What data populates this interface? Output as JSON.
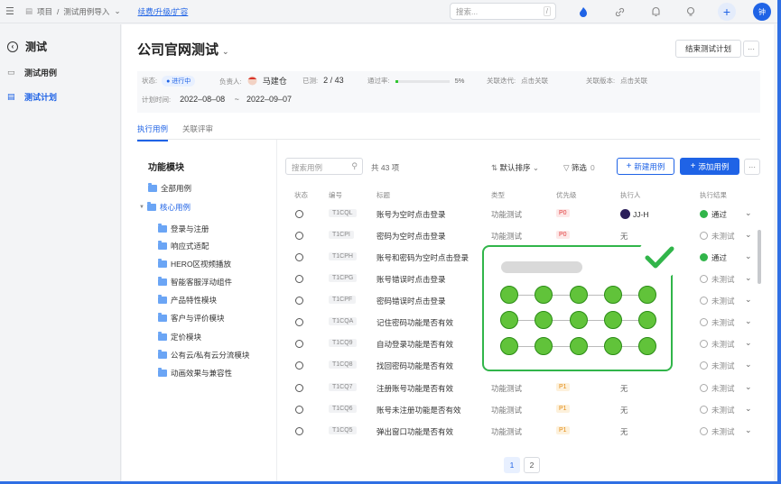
{
  "topbar": {
    "breadcrumb": [
      "项目",
      "/",
      "测试用例导入"
    ],
    "upgrade_link": "续费/升级/扩容",
    "search_placeholder": "搜索...",
    "search_shortcut": "/",
    "user_initial": "钟"
  },
  "sidebar": {
    "title": "测试",
    "items": [
      {
        "label": "测试用例",
        "icon": "file-icon",
        "active": false
      },
      {
        "label": "测试计划",
        "icon": "plan-icon",
        "active": true
      }
    ]
  },
  "page": {
    "title": "公司官网测试",
    "end_button": "结束测试计划",
    "more": "···"
  },
  "info": {
    "status_label": "状态:",
    "status_value": "进行中",
    "owner_label": "负责人:",
    "owner_value": "马建仓",
    "tested_label": "已测:",
    "tested_value": "2 / 43",
    "pass_rate_label": "通过率:",
    "pass_rate_value": "5%",
    "pass_rate_fraction": 0.05,
    "iteration_label": "关联迭代:",
    "iteration_value": "点击关联",
    "version_label": "关联版本:",
    "version_value": "点击关联",
    "plan_time_label": "计划时间:",
    "start_date": "2022–08–08",
    "date_sep": "~",
    "end_date": "2022–09–07"
  },
  "tabs": [
    "执行用例",
    "关联评审"
  ],
  "tree": {
    "heading": "功能模块",
    "nodes": [
      {
        "label": "全部用例",
        "level": 0
      },
      {
        "label": "核心用例",
        "level": 0,
        "expanded": true
      },
      {
        "label": "登录与注册",
        "level": 1
      },
      {
        "label": "响应式适配",
        "level": 1
      },
      {
        "label": "HERO区视频播放",
        "level": 1
      },
      {
        "label": "智能客服浮动组件",
        "level": 1
      },
      {
        "label": "产品特性模块",
        "level": 1
      },
      {
        "label": "客户与评价模块",
        "level": 1
      },
      {
        "label": "定价模块",
        "level": 1
      },
      {
        "label": "公有云/私有云分流模块",
        "level": 1
      },
      {
        "label": "动画效果与兼容性",
        "level": 1
      }
    ]
  },
  "toolbar": {
    "search_placeholder": "搜索用例",
    "count": "共 43 项",
    "sort": "默认排序",
    "filter": "筛选",
    "filter_count": "0",
    "new_case": "新建用例",
    "add_case": "添加用例"
  },
  "table": {
    "columns": [
      "状态",
      "编号",
      "标题",
      "类型",
      "优先级",
      "执行人",
      "执行结果"
    ],
    "rows": [
      {
        "code": "T1CQL",
        "title": "账号为空时点击登录",
        "type": "功能测试",
        "priority": "P0",
        "executor": "JJ-H",
        "result": "通过"
      },
      {
        "code": "T1CPI",
        "title": "密码为空时点击登录",
        "type": "功能测试",
        "priority": "P0",
        "executor": "无",
        "result": "未测试"
      },
      {
        "code": "T1CPH",
        "title": "账号和密码为空时点击登录",
        "type": "",
        "priority": "",
        "executor": "",
        "result": "通过"
      },
      {
        "code": "T1CPG",
        "title": "账号错误时点击登录",
        "type": "",
        "priority": "",
        "executor": "",
        "result": "未测试"
      },
      {
        "code": "T1CPF",
        "title": "密码错误时点击登录",
        "type": "",
        "priority": "",
        "executor": "",
        "result": "未测试"
      },
      {
        "code": "T1CQA",
        "title": "记住密码功能是否有效",
        "type": "",
        "priority": "",
        "executor": "",
        "result": "未测试"
      },
      {
        "code": "T1CQ9",
        "title": "自动登录功能是否有效",
        "type": "",
        "priority": "",
        "executor": "",
        "result": "未测试"
      },
      {
        "code": "T1CQ8",
        "title": "找回密码功能是否有效",
        "type": "",
        "priority": "",
        "executor": "",
        "result": "未测试"
      },
      {
        "code": "T1CQ7",
        "title": "注册账号功能是否有效",
        "type": "功能测试",
        "priority": "P1",
        "executor": "无",
        "result": "未测试"
      },
      {
        "code": "T1CQ6",
        "title": "账号未注册功能是否有效",
        "type": "功能测试",
        "priority": "P1",
        "executor": "无",
        "result": "未测试"
      },
      {
        "code": "T1CQ5",
        "title": "弹出窗口功能是否有效",
        "type": "功能测试",
        "priority": "P1",
        "executor": "无",
        "result": "未测试"
      }
    ]
  },
  "pagination": [
    "1",
    "2"
  ],
  "colors": {
    "accent": "#1f63e6",
    "pass": "#31b54a",
    "overlay_border": "#31b54a",
    "dot_fill": "#61c33a"
  }
}
